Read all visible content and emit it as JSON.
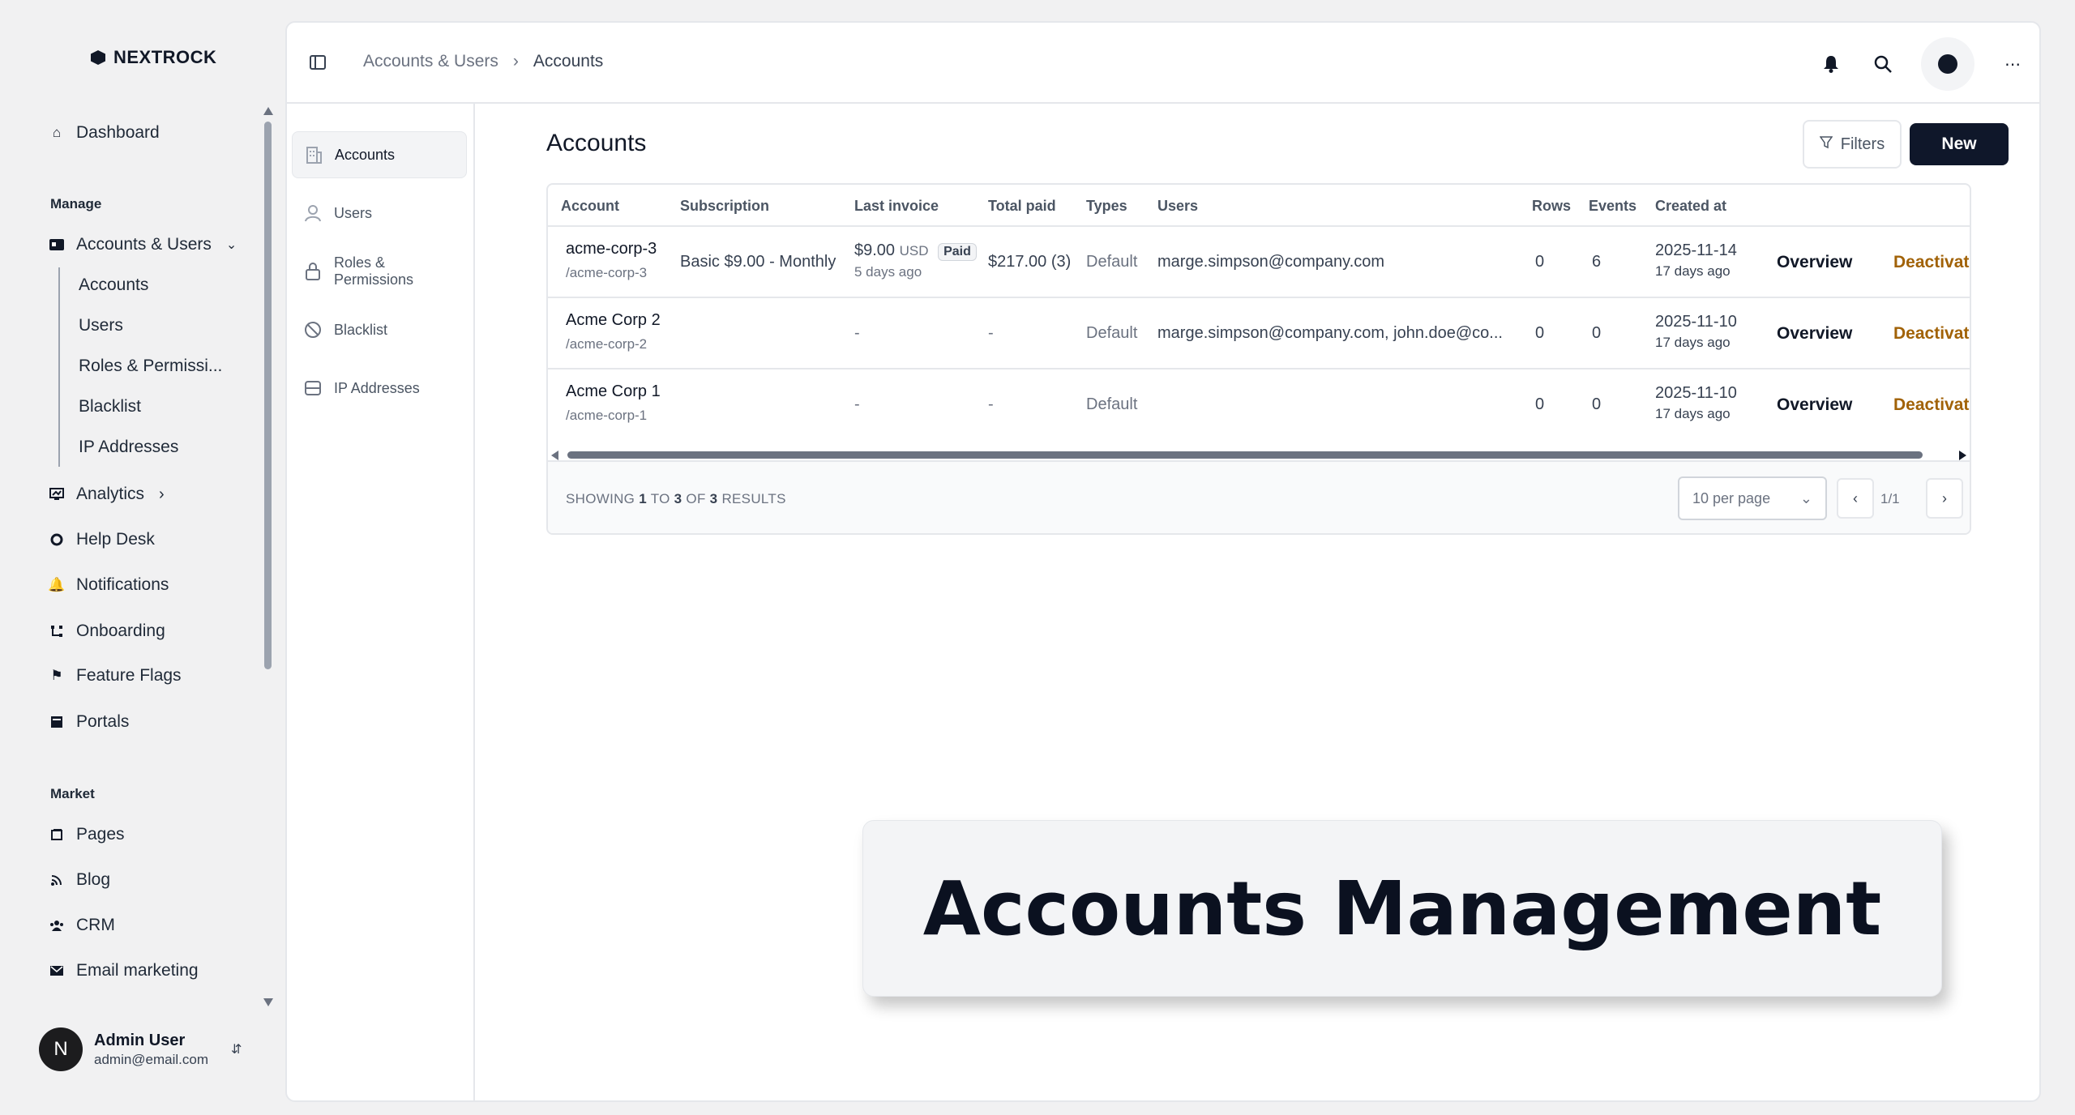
{
  "brand": {
    "name": "NEXTROCK"
  },
  "sidebar": {
    "top_items": [
      {
        "label": "Dashboard",
        "icon": "home-icon"
      }
    ],
    "sections": {
      "manage": "Manage",
      "market": "Market"
    },
    "manage_items": [
      {
        "label": "Accounts & Users",
        "icon": "id-card-icon"
      },
      {
        "label": "Analytics",
        "icon": "chart-icon"
      },
      {
        "label": "Help Desk",
        "icon": "lifebuoy-icon"
      },
      {
        "label": "Notifications",
        "icon": "bell-icon"
      },
      {
        "label": "Onboarding",
        "icon": "flow-icon"
      },
      {
        "label": "Feature Flags",
        "icon": "flag-icon"
      },
      {
        "label": "Portals",
        "icon": "portal-icon"
      }
    ],
    "accounts_users_children": [
      "Accounts",
      "Users",
      "Roles & Permissi...",
      "Blacklist",
      "IP Addresses"
    ],
    "market_items": [
      {
        "label": "Pages",
        "icon": "pages-icon"
      },
      {
        "label": "Blog",
        "icon": "rss-icon"
      },
      {
        "label": "CRM",
        "icon": "people-icon"
      },
      {
        "label": "Email marketing",
        "icon": "mail-icon"
      }
    ],
    "user": {
      "initial": "N",
      "name": "Admin User",
      "email": "admin@email.com"
    }
  },
  "topbar": {
    "breadcrumb": [
      "Accounts & Users",
      "Accounts"
    ],
    "separator": "›"
  },
  "subnav": {
    "items": [
      {
        "label": "Accounts",
        "icon": "building-icon",
        "active": true
      },
      {
        "label": "Users",
        "icon": "user-icon",
        "active": false
      },
      {
        "label": "Roles & Permissions",
        "icon": "lock-icon",
        "active": false
      },
      {
        "label": "Blacklist",
        "icon": "ban-icon",
        "active": false
      },
      {
        "label": "IP Addresses",
        "icon": "server-icon",
        "active": false
      }
    ]
  },
  "main": {
    "title": "Accounts",
    "filters_label": "Filters",
    "new_label": "New",
    "columns": [
      "Account",
      "Subscription",
      "Last invoice",
      "Total paid",
      "Types",
      "Users",
      "Rows",
      "Events",
      "Created at"
    ],
    "rows": [
      {
        "name": "acme-corp-3",
        "slug": "/acme-corp-3",
        "subscription": "Basic $9.00 - Monthly",
        "invoice_amount": "$9.00",
        "invoice_currency": "USD",
        "invoice_status": "Paid",
        "invoice_ago": "5 days ago",
        "total_paid": "$217.00 (3)",
        "type": "Default",
        "users": "marge.simpson@company.com",
        "rows": "0",
        "events": "6",
        "created": "2025-11-14",
        "created_ago": "17 days ago",
        "overview": "Overview",
        "deactivate": "Deactivate"
      },
      {
        "name": "Acme Corp 2",
        "slug": "/acme-corp-2",
        "subscription": "",
        "invoice_amount": "-",
        "invoice_currency": "",
        "invoice_status": "",
        "invoice_ago": "",
        "total_paid": "-",
        "type": "Default",
        "users": "marge.simpson@company.com, john.doe@co...",
        "rows": "0",
        "events": "0",
        "created": "2025-11-10",
        "created_ago": "17 days ago",
        "overview": "Overview",
        "deactivate": "Deactivate"
      },
      {
        "name": "Acme Corp 1",
        "slug": "/acme-corp-1",
        "subscription": "",
        "invoice_amount": "-",
        "invoice_currency": "",
        "invoice_status": "",
        "invoice_ago": "",
        "total_paid": "-",
        "type": "Default",
        "users": "",
        "rows": "0",
        "events": "0",
        "created": "2025-11-10",
        "created_ago": "17 days ago",
        "overview": "Overview",
        "deactivate": "Deactivate"
      }
    ],
    "footer": {
      "showing_prefix": "SHOWING ",
      "showing_from": "1",
      "showing_to_label": " TO ",
      "showing_to": "3",
      "showing_of_label": " OF ",
      "showing_total": "3",
      "showing_suffix": " RESULTS",
      "per_page": "10 per page",
      "page": "1/1",
      "prev": "‹",
      "next": "›"
    }
  },
  "caption": {
    "text": "Accounts Management"
  },
  "colors": {
    "primary": "#0f172a",
    "warning": "#a16207",
    "background": "#f1f1f2"
  }
}
